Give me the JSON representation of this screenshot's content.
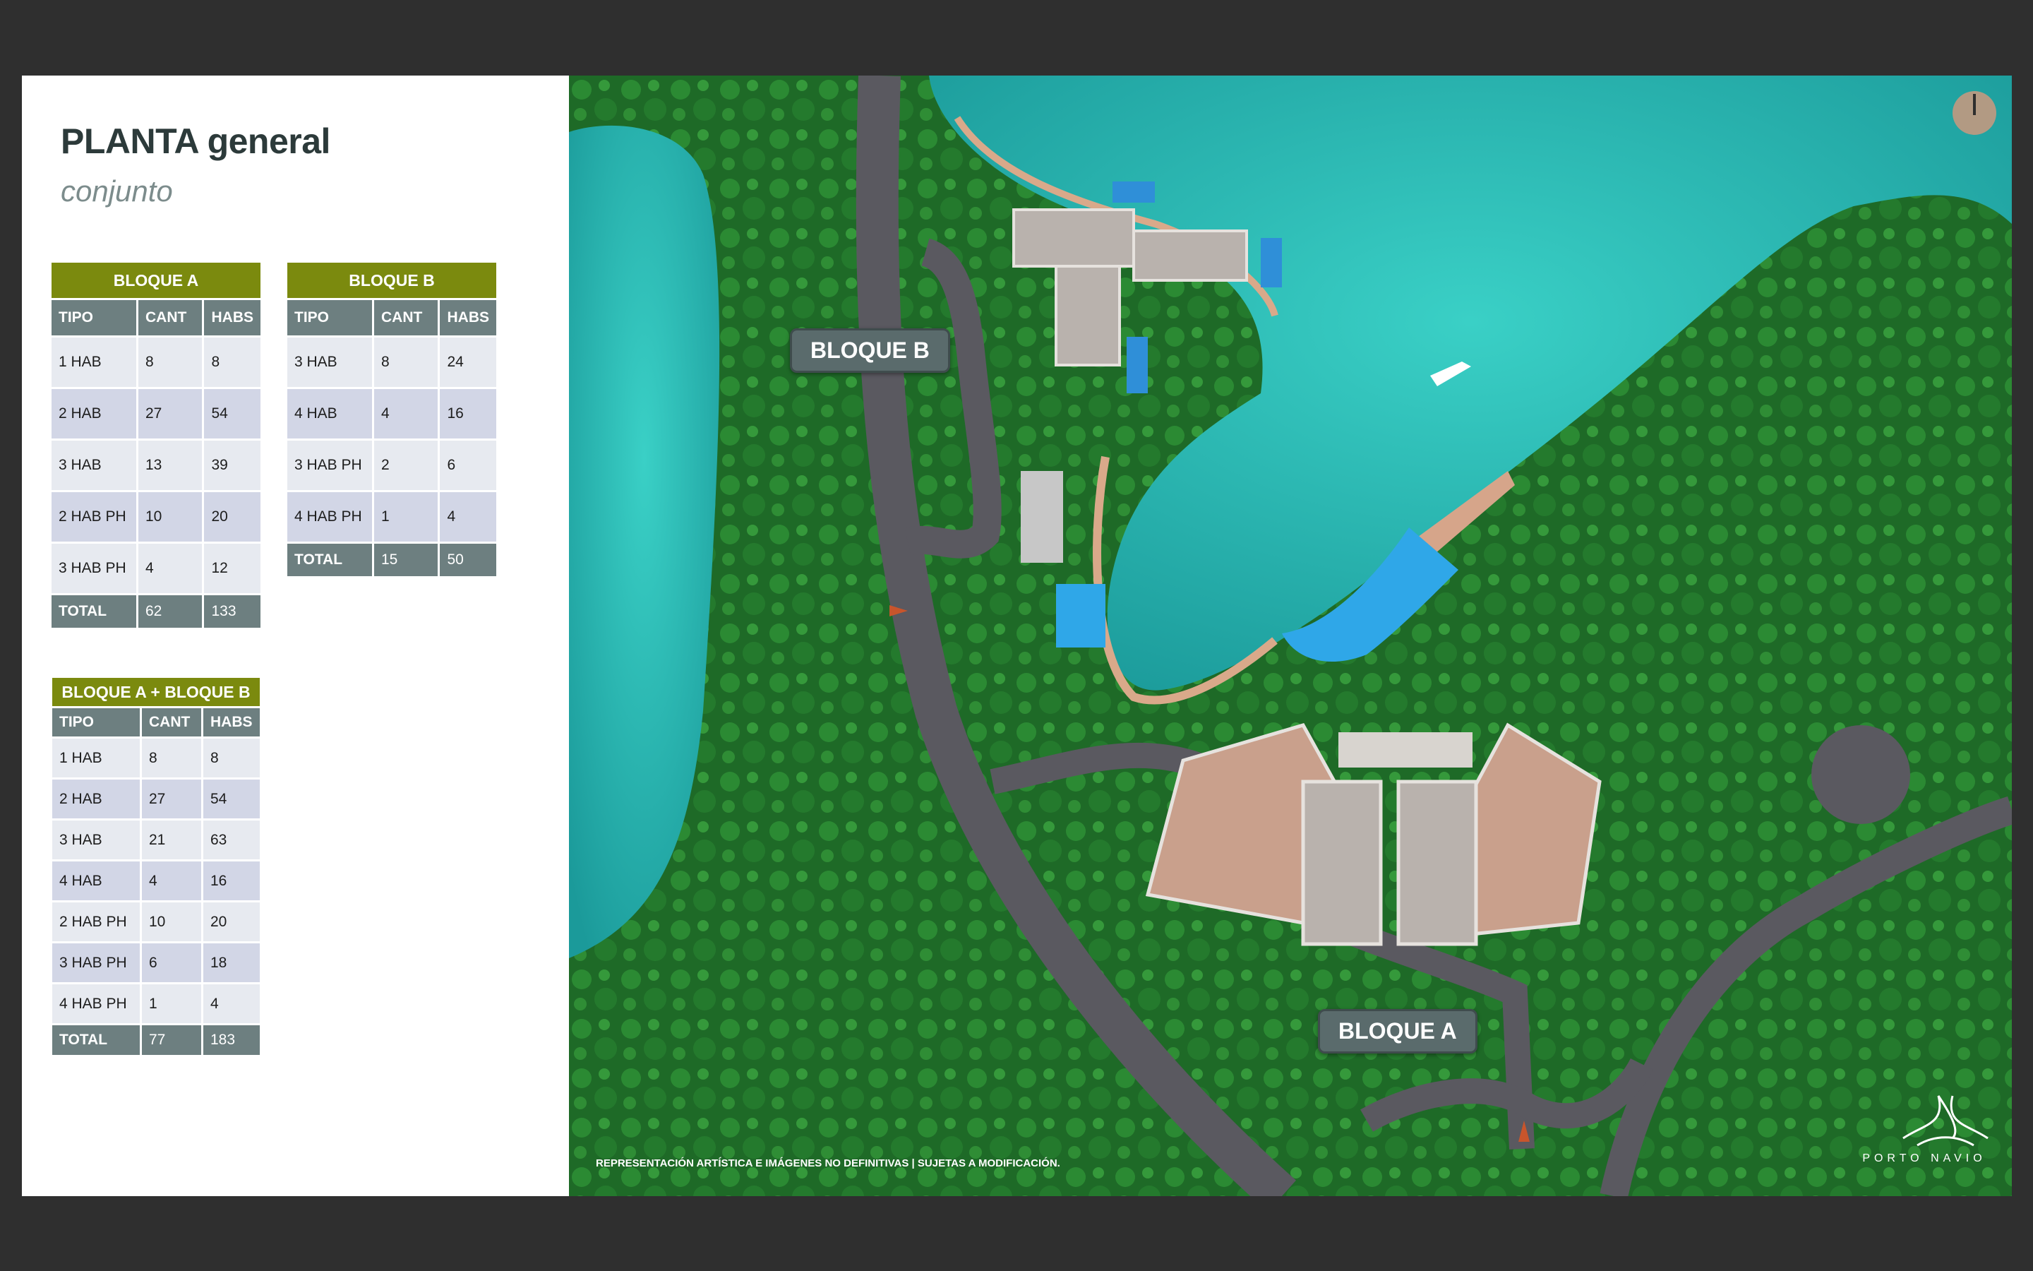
{
  "header": {
    "title": "PLANTA general",
    "subtitle": "conjunto"
  },
  "bloque_a": {
    "title": "BLOQUE A",
    "columns": [
      "TIPO",
      "CANT",
      "HABS"
    ],
    "rows": [
      [
        "1 HAB",
        "8",
        "8"
      ],
      [
        "2 HAB",
        "27",
        "54"
      ],
      [
        "3 HAB",
        "13",
        "39"
      ],
      [
        "2 HAB PH",
        "10",
        "20"
      ],
      [
        "3 HAB PH",
        "4",
        "12"
      ]
    ],
    "total": [
      "TOTAL",
      "62",
      "133"
    ]
  },
  "bloque_b": {
    "title": "BLOQUE B",
    "columns": [
      "TIPO",
      "CANT",
      "HABS"
    ],
    "rows": [
      [
        "3 HAB",
        "8",
        "24"
      ],
      [
        "4 HAB",
        "4",
        "16"
      ],
      [
        "3 HAB PH",
        "2",
        "6"
      ],
      [
        "4 HAB PH",
        "1",
        "4"
      ]
    ],
    "total": [
      "TOTAL",
      "15",
      "50"
    ]
  },
  "bloque_ab": {
    "title": "BLOQUE A + BLOQUE B",
    "columns": [
      "TIPO",
      "CANT",
      "HABS"
    ],
    "rows": [
      [
        "1 HAB",
        "8",
        "8"
      ],
      [
        "2 HAB",
        "27",
        "54"
      ],
      [
        "3 HAB",
        "21",
        "63"
      ],
      [
        "4 HAB",
        "4",
        "16"
      ],
      [
        "2 HAB PH",
        "10",
        "20"
      ],
      [
        "3 HAB PH",
        "6",
        "18"
      ],
      [
        "4 HAB PH",
        "1",
        "4"
      ]
    ],
    "total": [
      "TOTAL",
      "77",
      "183"
    ]
  },
  "map": {
    "label_bloque_b": "BLOQUE B",
    "label_bloque_a": "BLOQUE A",
    "disclaimer": "REPRESENTACIÓN ARTÍSTICA E IMÁGENES NO DEFINITIVAS | SUJETAS A MODIFICACIÓN.",
    "brand": "PORTO NAVIO",
    "compass_icon": "compass-icon",
    "logo_icon": "porto-navio-logo"
  },
  "colors": {
    "block_header": "#7b8a0e",
    "column_header": "#6d7f80",
    "row_light": "#e7eaf0",
    "row_dark": "#d2d6e6",
    "water": "#2fb8b4",
    "vegetation": "#1f6d2a"
  }
}
